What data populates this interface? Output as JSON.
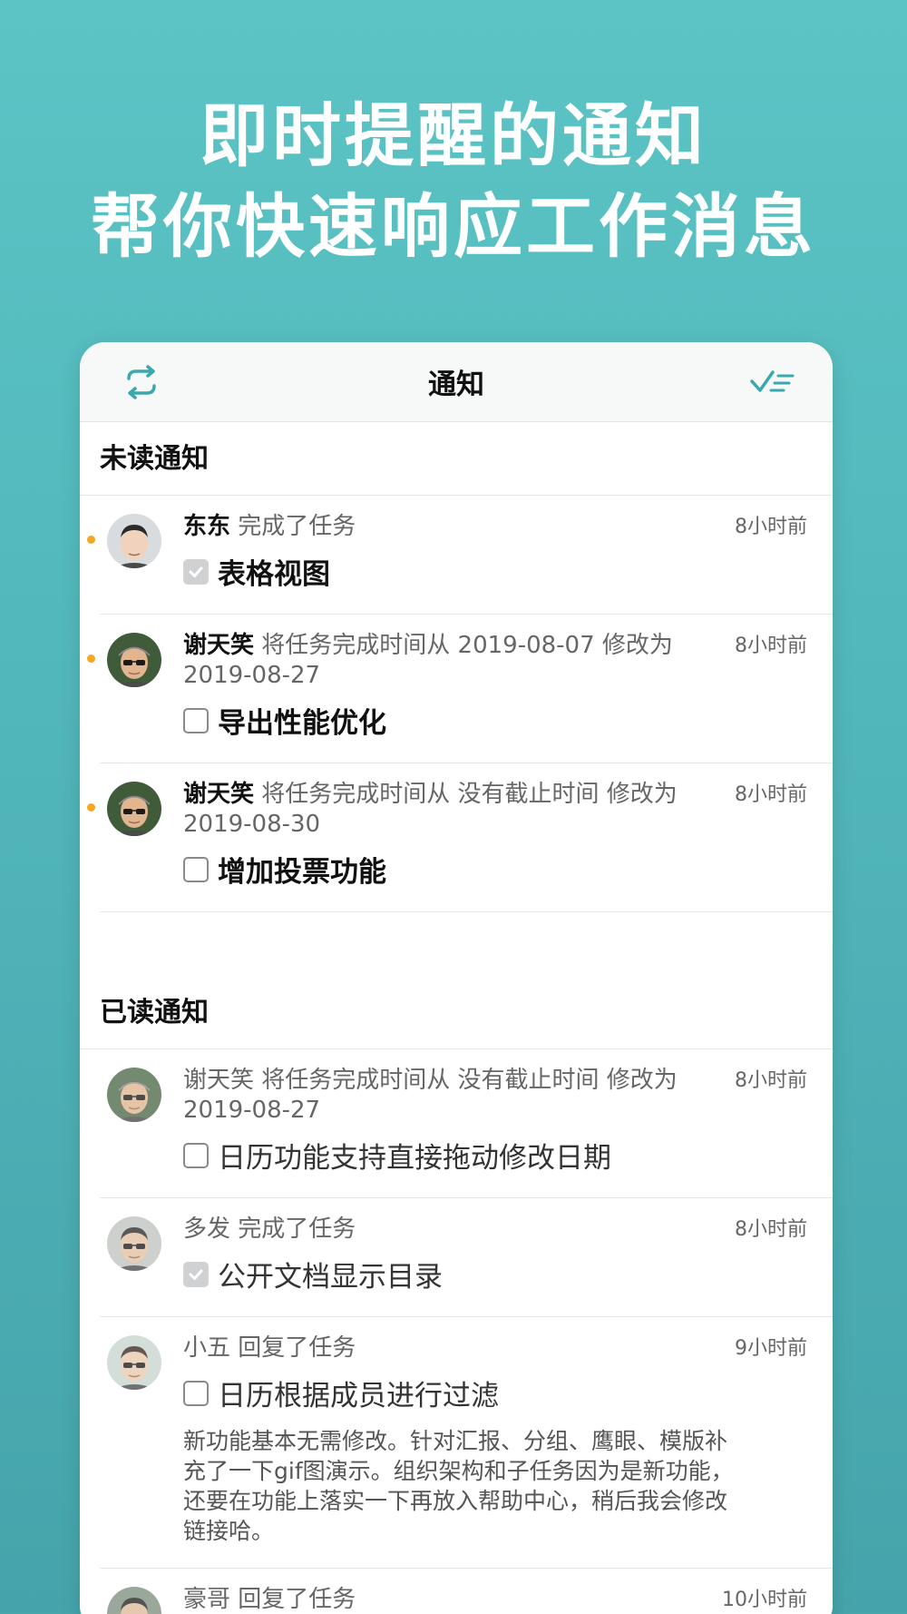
{
  "headline": {
    "line1": "即时提醒的通知",
    "line2": "帮你快速响应工作消息"
  },
  "navbar": {
    "title": "通知",
    "left_icon": "sync-icon",
    "right_icon": "mark-all-read-icon"
  },
  "colors": {
    "accent": "#4fb3b8",
    "unread_dot": "#f5a623"
  },
  "unread": {
    "title": "未读通知",
    "items": [
      {
        "user": "东东",
        "action": " 完成了任务",
        "time": "8小时前",
        "task": "表格视图",
        "checked": true
      },
      {
        "user": "谢天笑",
        "action": " 将任务完成时间从 2019-08-07 修改为 2019-08-27",
        "time": "8小时前",
        "task": "导出性能优化",
        "checked": false
      },
      {
        "user": "谢天笑",
        "action": " 将任务完成时间从 没有截止时间 修改为 2019-08-30",
        "time": "8小时前",
        "task": "增加投票功能",
        "checked": false
      }
    ]
  },
  "read": {
    "title": "已读通知",
    "items": [
      {
        "user": "谢天笑",
        "action": " 将任务完成时间从 没有截止时间 修改为 2019-08-27",
        "time": "8小时前",
        "task": "日历功能支持直接拖动修改日期",
        "checked": false
      },
      {
        "user": "多发",
        "action": " 完成了任务",
        "time": "8小时前",
        "task": "公开文档显示目录",
        "checked": true
      },
      {
        "user": "小五",
        "action": " 回复了任务",
        "time": "9小时前",
        "task": "日历根据成员进行过滤",
        "checked": false,
        "reply": "新功能基本无需修改。针对汇报、分组、鹰眼、模版补充了一下gif图演示。组织架构和子任务因为是新功能，还要在功能上落实一下再放入帮助中心，稍后我会修改链接哈。"
      },
      {
        "user": "豪哥",
        "action": " 回复了任务",
        "time": "10小时前",
        "task": "",
        "checked": false
      }
    ]
  }
}
